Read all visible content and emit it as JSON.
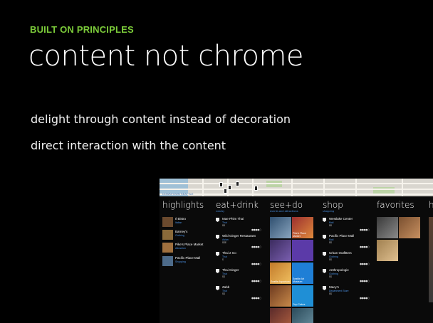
{
  "eyebrow": "BUILT ON PRINCIPLES",
  "headline": "content not chrome",
  "bullets": [
    "delight through content instead of decoration",
    "direct interaction with the content"
  ],
  "app": {
    "map_label": "DOWNTOWN SEATTLE",
    "sections": {
      "highlights": {
        "title": "highlights",
        "items": [
          {
            "name": "Il Bistro",
            "sub": "Italian"
          },
          {
            "name": "Barney's",
            "sub": "Clothing"
          },
          {
            "name": "Pike's Place Market",
            "sub": "Attraction"
          },
          {
            "name": "Pacific Place Mall",
            "sub": "Shopping"
          }
        ]
      },
      "eat_drink": {
        "title": "eat+drink",
        "sub": "nearby",
        "items": [
          {
            "name": "Mae Phim Thai",
            "sub": "Thai",
            "meta": "$$"
          },
          {
            "name": "Wild Ginger Restaurant",
            "sub": "Asian",
            "meta": "$$$"
          },
          {
            "name": "Thai 2 Go",
            "sub": "Thai",
            "meta": "$"
          },
          {
            "name": "Thai Ginger",
            "sub": "Thai",
            "meta": "$$"
          },
          {
            "name": "Zabb",
            "sub": "Thai",
            "meta": "$$"
          }
        ]
      },
      "see_do": {
        "title": "see+do",
        "sub": "events and attractions",
        "tiles": [
          {
            "label": ""
          },
          {
            "label": "Pike's Place Market"
          },
          {
            "label": ""
          },
          {
            "label": ""
          },
          {
            "label": "Seattle Aquarium"
          },
          {
            "label": "Seattle Art Museum"
          },
          {
            "label": ""
          },
          {
            "label": "Cup Cakes"
          },
          {
            "label": ""
          },
          {
            "label": ""
          }
        ]
      },
      "shop": {
        "title": "shop",
        "sub": "shopping",
        "items": [
          {
            "name": "Westlake Center",
            "sub": "Mall",
            "meta": "$$"
          },
          {
            "name": "Pacific Place Mall",
            "sub": "Mall",
            "meta": "$$"
          },
          {
            "name": "Urban Outfitters",
            "sub": "Clothing",
            "meta": "$$"
          },
          {
            "name": "Anthropologie",
            "sub": "Clothing",
            "meta": "$$"
          },
          {
            "name": "Macy's",
            "sub": "Department Store",
            "meta": "$$"
          }
        ]
      },
      "favorites": {
        "title": "favorites"
      },
      "next": {
        "title": "h"
      }
    },
    "rating": "●●●●○",
    "colors": {
      "accent_green": "#7ccc3a",
      "link_blue": "#4a90e2"
    }
  }
}
